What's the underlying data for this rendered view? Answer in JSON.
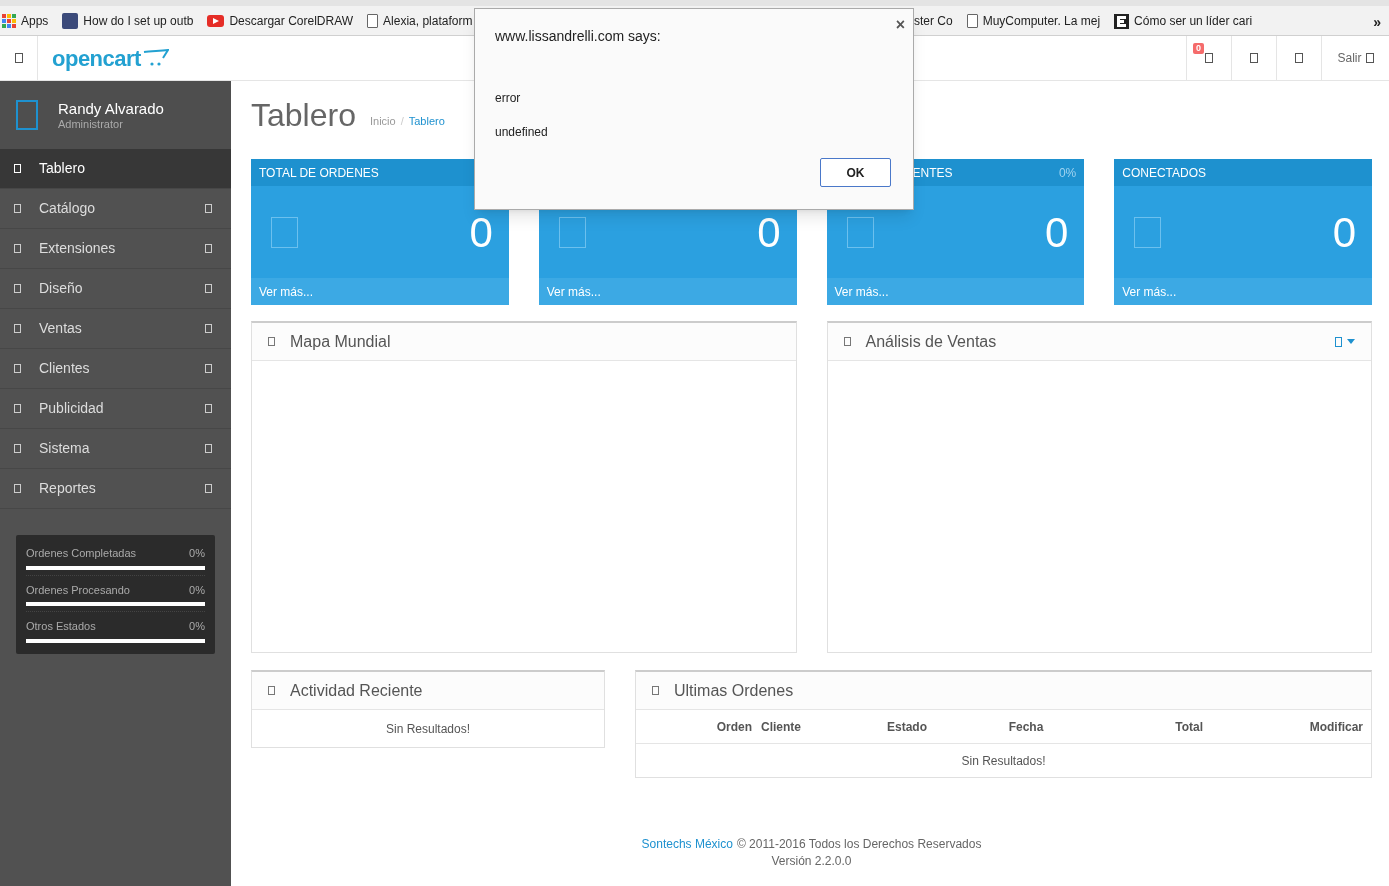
{
  "bookmarks_bar": {
    "left": [
      {
        "kind": "apps",
        "label": "Apps"
      },
      {
        "kind": "k",
        "label": "How do I set up outb"
      },
      {
        "kind": "video",
        "label": "Descargar CorelDRAW"
      },
      {
        "kind": "page",
        "label": "Alexia, plataform"
      }
    ],
    "right": [
      {
        "kind": "cut",
        "label": "ster Co"
      },
      {
        "kind": "page",
        "label": "MuyComputer. La mej"
      },
      {
        "kind": "e",
        "label": "Cómo ser un líder cari"
      }
    ],
    "overflow": "»"
  },
  "header": {
    "logo": "opencart",
    "notification_count": "0",
    "logout": "Salir"
  },
  "user": {
    "name": "Randy Alvarado",
    "role": "Administrator"
  },
  "menu": [
    {
      "label": "Tablero",
      "selected": true,
      "expandable": false
    },
    {
      "label": "Catálogo",
      "selected": false,
      "expandable": true
    },
    {
      "label": "Extensiones",
      "selected": false,
      "expandable": true
    },
    {
      "label": "Diseño",
      "selected": false,
      "expandable": true
    },
    {
      "label": "Ventas",
      "selected": false,
      "expandable": true
    },
    {
      "label": "Clientes",
      "selected": false,
      "expandable": true
    },
    {
      "label": "Publicidad",
      "selected": false,
      "expandable": true
    },
    {
      "label": "Sistema",
      "selected": false,
      "expandable": true
    },
    {
      "label": "Reportes",
      "selected": false,
      "expandable": true
    }
  ],
  "order_stats": [
    {
      "label": "Ordenes Completadas",
      "reading": "0%",
      "level": 0
    },
    {
      "label": "Ordenes Procesando",
      "reading": "0%",
      "level": 0
    },
    {
      "label": "Otros Estados",
      "reading": "0%",
      "level": 0
    }
  ],
  "page": {
    "title": "Tablero",
    "breadcrumb": [
      "Inicio",
      "Tablero"
    ],
    "breadcrumb_separator": "/"
  },
  "tiles": [
    {
      "title": "TOTAL DE ORDENES",
      "value": "0",
      "link": "Ver más..."
    },
    {
      "value": "0",
      "link": "Ver más..."
    },
    {
      "title": "ENTES",
      "percent": "0%",
      "value": "0",
      "link": "Ver más..."
    },
    {
      "title": "CONECTADOS",
      "value": "0",
      "link": "Ver más..."
    }
  ],
  "map_panel": {
    "title": "Mapa Mundial"
  },
  "sales_panel": {
    "title": "Análisis de Ventas"
  },
  "activity_panel": {
    "title": "Actividad Reciente",
    "empty": "Sin Resultados!"
  },
  "orders_panel": {
    "title": "Ultimas Ordenes",
    "columns": [
      "Orden",
      "Cliente",
      "Estado",
      "Fecha",
      "Total",
      "Modificar"
    ],
    "empty": "Sin Resultados!"
  },
  "footer": {
    "link": "Sontechs México",
    "text": "© 2011-2016 Todos los Derechos Reservados",
    "version": "Versión 2.2.0.0"
  },
  "dialog": {
    "title": "www.lissandrelli.com says:",
    "close": "×",
    "messages": [
      "error",
      "undefined"
    ],
    "button": "OK"
  }
}
